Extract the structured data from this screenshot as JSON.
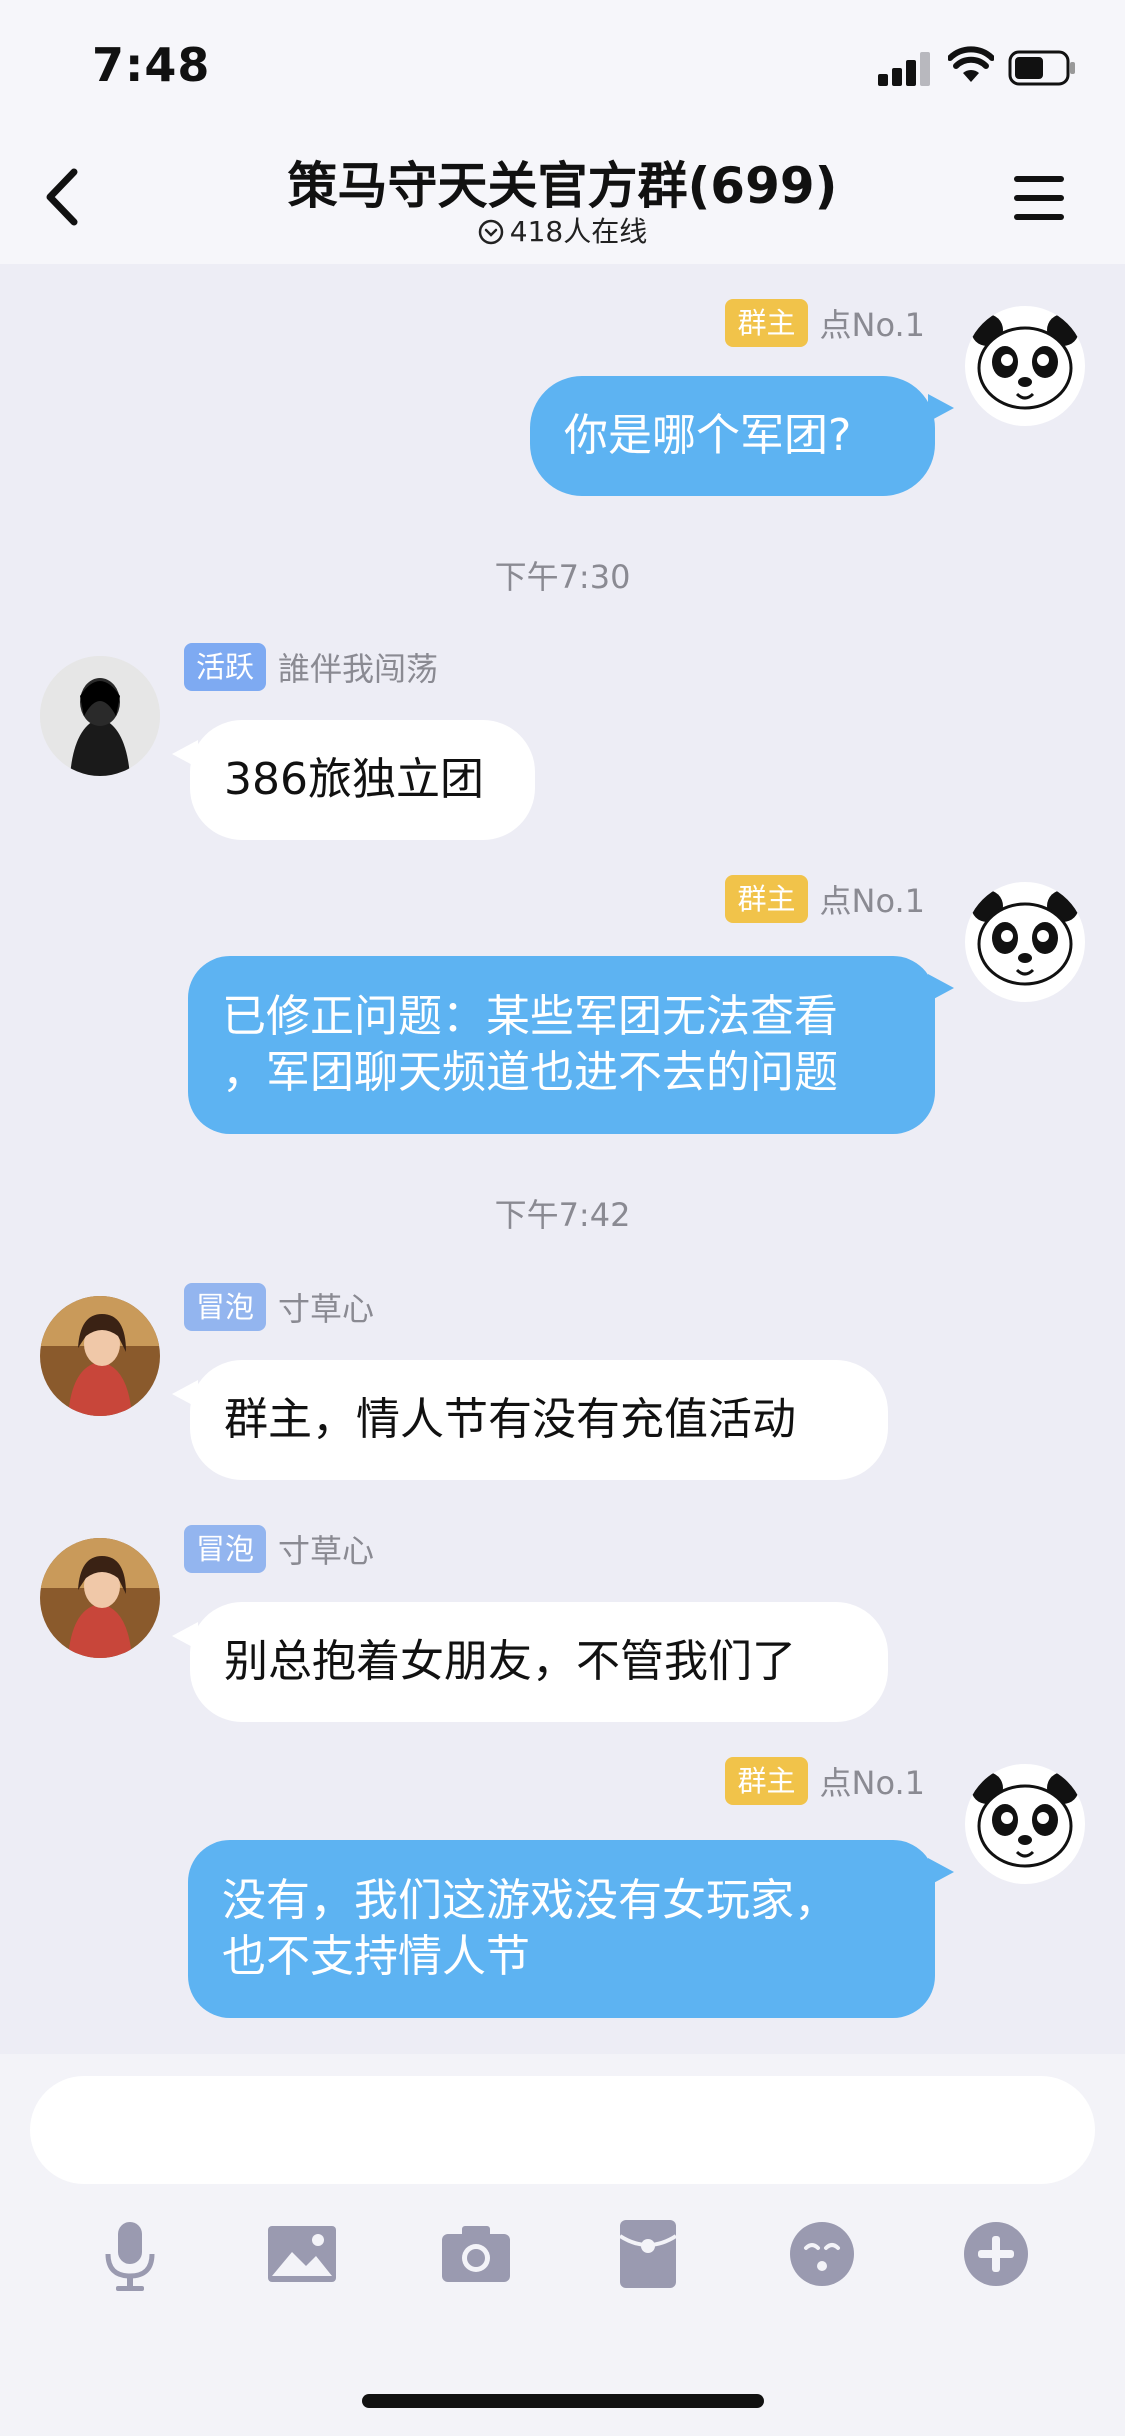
{
  "status": {
    "time": "7:48"
  },
  "header": {
    "title": "策马守天关官方群(699)",
    "online": "418人在线"
  },
  "messages": [
    {
      "direction": "out",
      "tag": "群主",
      "sender": "点No.1",
      "lines": [
        "你是哪个军团?"
      ]
    },
    {
      "timestamp": "下午7:30"
    },
    {
      "direction": "in",
      "tag": "活跃",
      "sender": "誰伴我闯荡",
      "lines": [
        "386旅独立团"
      ]
    },
    {
      "direction": "out",
      "tag": "群主",
      "sender": "点No.1",
      "lines": [
        "已修正问题：某些军团无法查看",
        "，军团聊天频道也进不去的问题"
      ]
    },
    {
      "timestamp": "下午7:42"
    },
    {
      "direction": "in",
      "tag": "冒泡",
      "sender": "寸草心",
      "lines": [
        "群主，情人节有没有充值活动"
      ]
    },
    {
      "direction": "in",
      "tag": "冒泡",
      "sender": "寸草心",
      "lines": [
        "别总抱着女朋友，不管我们了"
      ]
    },
    {
      "direction": "out",
      "tag": "群主",
      "sender": "点No.1",
      "lines": [
        "没有，我们这游戏没有女玩家，",
        "也不支持情人节"
      ]
    }
  ],
  "input": {
    "value": "",
    "placeholder": ""
  },
  "toolbar": {
    "icons": [
      "microphone-icon",
      "image-icon",
      "camera-icon",
      "red-packet-icon",
      "emoji-icon",
      "plus-icon"
    ]
  },
  "colors": {
    "accent_bubble": "#5db3f2",
    "owner_tag": "#f1c34a",
    "active_tag": "#7eaaf2",
    "bubble_tag": "#93b5ef",
    "background": "#ededf5"
  }
}
